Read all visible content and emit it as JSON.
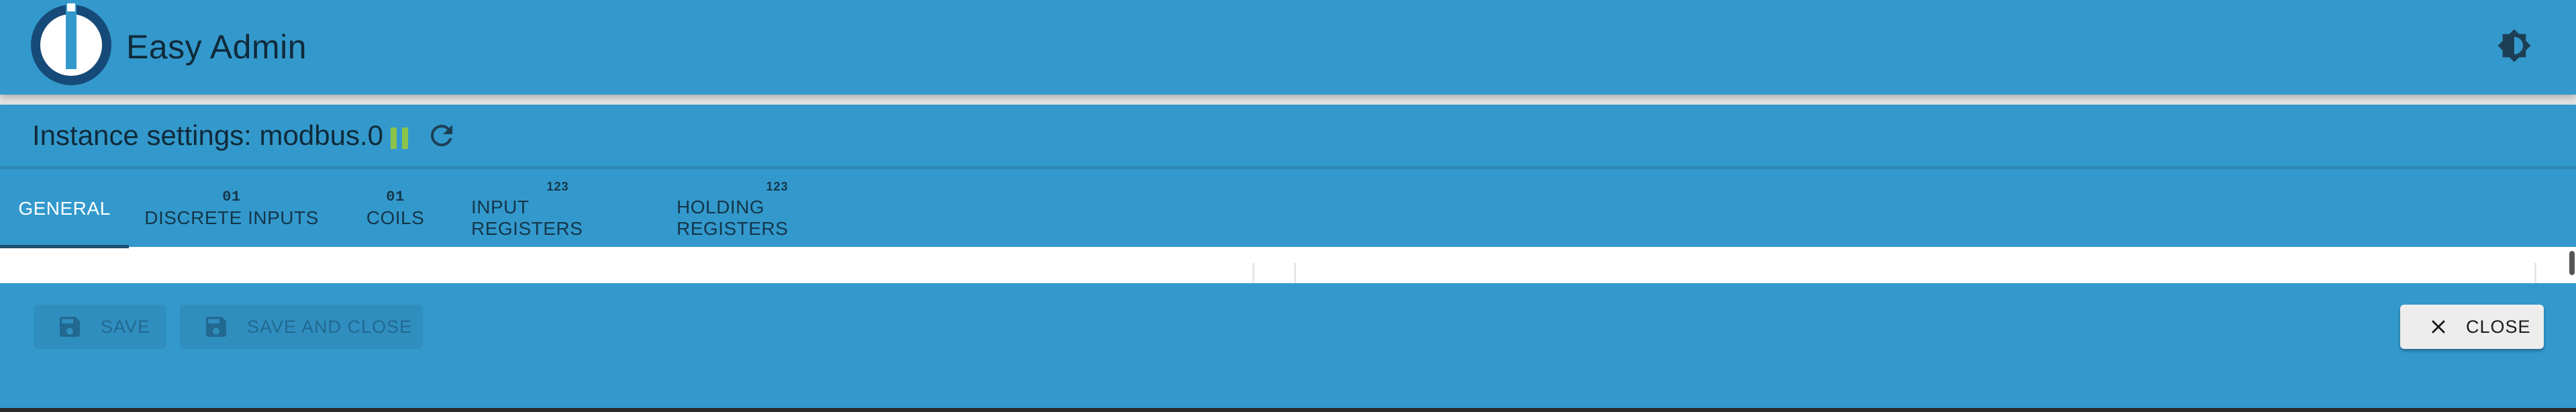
{
  "app": {
    "title": "Easy Admin"
  },
  "instance": {
    "title": "Instance settings: modbus.0",
    "status_color": "#8bc34a"
  },
  "tabs": [
    {
      "icon": "",
      "label": "General",
      "active": true
    },
    {
      "icon": "01",
      "label": "Discrete inputs",
      "active": false
    },
    {
      "icon": "01",
      "label": "Coils",
      "active": false
    },
    {
      "icon": "123",
      "label": "Input Registers",
      "active": false
    },
    {
      "icon": "123",
      "label": "Holding Registers",
      "active": false
    }
  ],
  "footer": {
    "save_label": "Save",
    "save_close_label": "Save and close",
    "close_label": "Close"
  },
  "colors": {
    "primary": "#3399cc",
    "gap": "#e4e4e4",
    "active_tab_indicator": "#1f4f73"
  },
  "icons": {
    "logo": "iobroker-logo-icon",
    "theme": "brightness-icon",
    "pause": "pause-icon",
    "refresh": "refresh-icon",
    "save": "floppy-disk-icon",
    "close": "close-icon"
  }
}
